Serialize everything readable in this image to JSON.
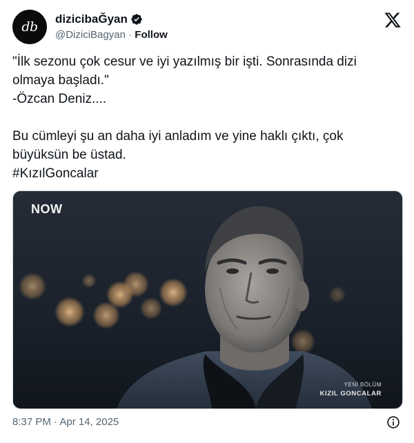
{
  "author": {
    "avatar_text": "db",
    "display_name": "dizicibaĞyan",
    "handle": "@DiziciBagyan",
    "separator": "·",
    "follow_label": "Follow"
  },
  "tweet": {
    "lines": [
      "\"İlk sezonu çok cesur ve iyi yazılmış bir işti. Sonrasında dizi olmaya başladı.\"",
      "-Özcan Deniz....",
      "Bu cümleyi şu an daha iyi anladım ve yine haklı çıktı, çok büyüksün be üstad.",
      "#KızılGoncalar"
    ]
  },
  "media": {
    "channel_logo": "NOW",
    "caption_sub": "YENİ BÖLÜM",
    "caption_main": "KIZIL GONCALAR"
  },
  "footer": {
    "timestamp": "8:37 PM · Apr 14, 2025"
  },
  "icons": {
    "verified": "verified-badge-icon",
    "x_logo": "x-logo-icon",
    "info": "info-icon"
  },
  "colors": {
    "text_primary": "#0f1419",
    "text_secondary": "#536471",
    "background": "#ffffff"
  }
}
